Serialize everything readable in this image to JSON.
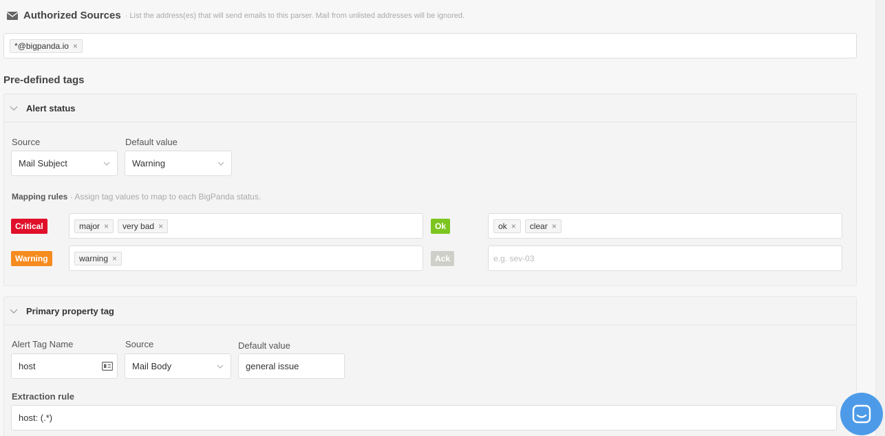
{
  "auth": {
    "title": "Authorized Sources",
    "subtitle": "· List the address(es) that will send emails to this parser. Mail from unlisted addresses will be ignored.",
    "chips": [
      "*@bigpanda.io"
    ]
  },
  "predefined": {
    "title": "Pre-defined tags"
  },
  "alert_status": {
    "title": "Alert status",
    "source_label": "Source",
    "source_value": "Mail Subject",
    "default_label": "Default value",
    "default_value": "Warning",
    "mapping_title": "Mapping rules",
    "mapping_sub": "· Assign tag values to map to each BigPanda status.",
    "critical": {
      "label": "Critical",
      "color": "#e0102a",
      "tags": [
        "major",
        "very bad"
      ]
    },
    "warning": {
      "label": "Warning",
      "color": "#f68b1f",
      "tags": [
        "warning"
      ]
    },
    "ok": {
      "label": "Ok",
      "color": "#7cc520",
      "tags": [
        "ok",
        "clear"
      ]
    },
    "ack": {
      "label": "Ack",
      "color": "#cfcfc9",
      "placeholder": "e.g. sev-03"
    }
  },
  "primary": {
    "title": "Primary property tag",
    "tag_name_label": "Alert Tag Name",
    "tag_name_value": "host",
    "source_label": "Source",
    "source_value": "Mail Body",
    "default_label": "Default value",
    "default_value": "general issue",
    "extraction_label": "Extraction rule",
    "extraction_value": "host: (.*)"
  },
  "icons": {
    "mail": "mail-icon",
    "chevron": "chevron-down-icon",
    "remove": "close-icon",
    "card": "id-card-icon",
    "chat": "chat-icon"
  },
  "remove_glyph": "×"
}
